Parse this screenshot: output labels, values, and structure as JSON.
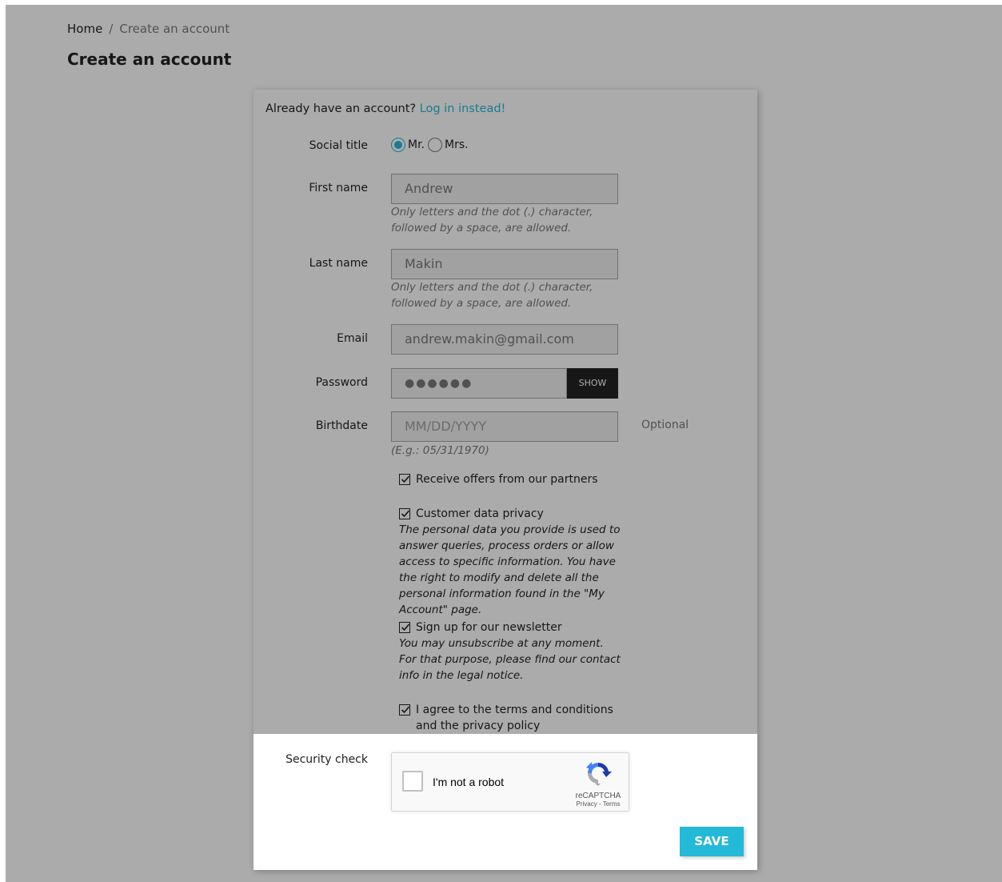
{
  "breadcrumb": {
    "home": "Home",
    "separator": "/",
    "current": "Create an account"
  },
  "page_title": "Create an account",
  "login_prompt": {
    "text": "Already have an account?",
    "link": "Log in instead!"
  },
  "form": {
    "social_title": {
      "label": "Social title",
      "options": [
        "Mr.",
        "Mrs."
      ],
      "selected": "Mr."
    },
    "first_name": {
      "label": "First name",
      "value": "Andrew",
      "hint": "Only letters and the dot (.) character, followed by a space, are allowed."
    },
    "last_name": {
      "label": "Last name",
      "value": "Makin",
      "hint": "Only letters and the dot (.) character, followed by a space, are allowed."
    },
    "email": {
      "label": "Email",
      "value": "andrew.makin@gmail.com"
    },
    "password": {
      "label": "Password",
      "value": "●●●●●●",
      "show_label": "SHOW"
    },
    "birthdate": {
      "label": "Birthdate",
      "placeholder": "MM/DD/YYYY",
      "hint": "(E.g.: 05/31/1970)",
      "optional": "Optional"
    },
    "checkboxes": {
      "partners": {
        "label": "Receive offers from our partners",
        "checked": true
      },
      "privacy": {
        "label": "Customer data privacy",
        "checked": true,
        "description": "The personal data you provide is used to answer queries, process orders or allow access to specific information. You have the right to modify and delete all the personal information found in the \"My Account\" page."
      },
      "newsletter": {
        "label": "Sign up for our newsletter",
        "checked": true,
        "description": "You may unsubscribe at any moment. For that purpose, please find our contact info in the legal notice."
      },
      "terms": {
        "label": "I agree to the terms and conditions and the privacy policy",
        "checked": true
      }
    },
    "security_check": {
      "label": "Security check",
      "captcha_text": "I'm not a robot",
      "brand": "reCAPTCHA",
      "links": "Privacy - Terms"
    },
    "save_label": "SAVE"
  },
  "colors": {
    "accent": "#24b9d7",
    "overlay": "rgba(0,0,0,0.33)",
    "show_button": "#232323"
  }
}
